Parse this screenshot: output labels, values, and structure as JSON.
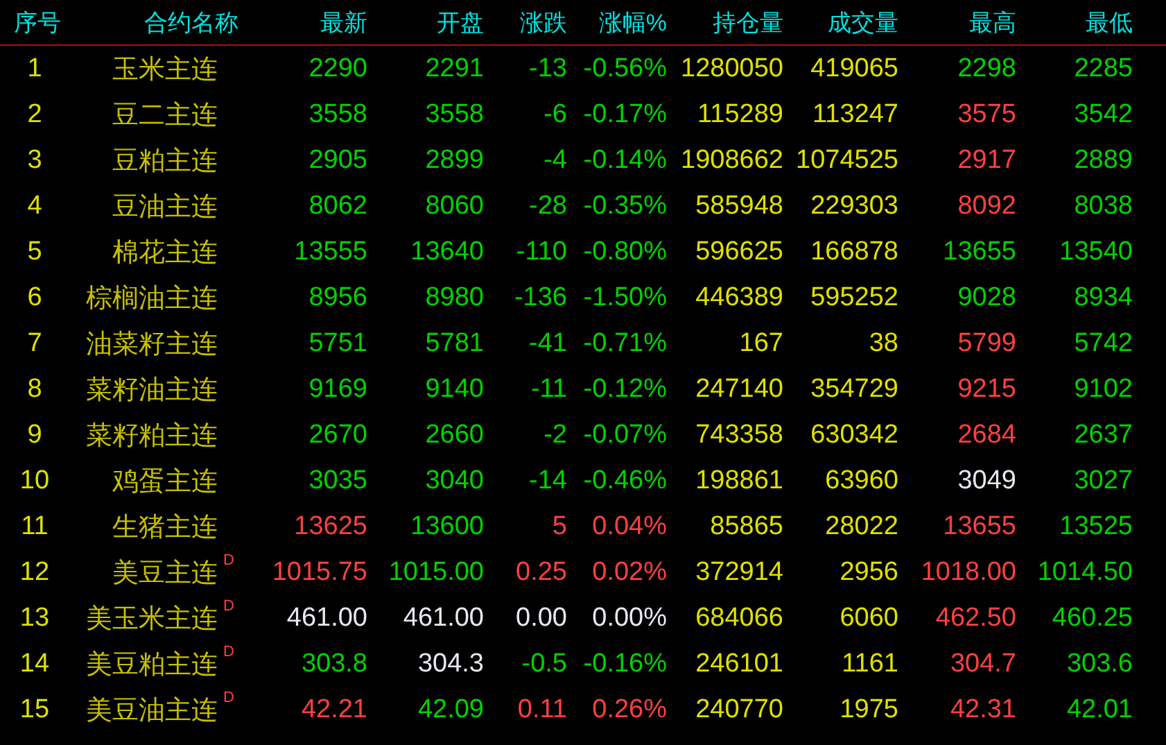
{
  "columns": [
    "序号",
    "合约名称",
    "最新",
    "开盘",
    "涨跌",
    "涨幅%",
    "持仓量",
    "成交量",
    "最高",
    "最低"
  ],
  "rows": [
    {
      "no": "1",
      "name": "玉米主连",
      "last": {
        "text": "2290",
        "color": "#00d200"
      },
      "open": {
        "text": "2291",
        "color": "#00d200"
      },
      "change": {
        "text": "-13",
        "color": "#00d200"
      },
      "pct": {
        "text": "-0.56%",
        "color": "#00d200"
      },
      "oi": "1280050",
      "volume": "419065",
      "high": {
        "text": "2298",
        "color": "#00d200"
      },
      "low": {
        "text": "2285",
        "color": "#00d200"
      }
    },
    {
      "no": "2",
      "name": "豆二主连",
      "last": {
        "text": "3558",
        "color": "#00d200"
      },
      "open": {
        "text": "3558",
        "color": "#00d200"
      },
      "change": {
        "text": "-6",
        "color": "#00d200"
      },
      "pct": {
        "text": "-0.17%",
        "color": "#00d200"
      },
      "oi": "115289",
      "volume": "113247",
      "high": {
        "text": "3575",
        "color": "#ff4040"
      },
      "low": {
        "text": "3542",
        "color": "#00d200"
      }
    },
    {
      "no": "3",
      "name": "豆粕主连",
      "last": {
        "text": "2905",
        "color": "#00d200"
      },
      "open": {
        "text": "2899",
        "color": "#00d200"
      },
      "change": {
        "text": "-4",
        "color": "#00d200"
      },
      "pct": {
        "text": "-0.14%",
        "color": "#00d200"
      },
      "oi": "1908662",
      "volume": "1074525",
      "high": {
        "text": "2917",
        "color": "#ff4040"
      },
      "low": {
        "text": "2889",
        "color": "#00d200"
      }
    },
    {
      "no": "4",
      "name": "豆油主连",
      "last": {
        "text": "8062",
        "color": "#00d200"
      },
      "open": {
        "text": "8060",
        "color": "#00d200"
      },
      "change": {
        "text": "-28",
        "color": "#00d200"
      },
      "pct": {
        "text": "-0.35%",
        "color": "#00d200"
      },
      "oi": "585948",
      "volume": "229303",
      "high": {
        "text": "8092",
        "color": "#ff4040"
      },
      "low": {
        "text": "8038",
        "color": "#00d200"
      }
    },
    {
      "no": "5",
      "name": "棉花主连",
      "last": {
        "text": "13555",
        "color": "#00d200"
      },
      "open": {
        "text": "13640",
        "color": "#00d200"
      },
      "change": {
        "text": "-110",
        "color": "#00d200"
      },
      "pct": {
        "text": "-0.80%",
        "color": "#00d200"
      },
      "oi": "596625",
      "volume": "166878",
      "high": {
        "text": "13655",
        "color": "#00d200"
      },
      "low": {
        "text": "13540",
        "color": "#00d200"
      }
    },
    {
      "no": "6",
      "name": "棕榈油主连",
      "last": {
        "text": "8956",
        "color": "#00d200"
      },
      "open": {
        "text": "8980",
        "color": "#00d200"
      },
      "change": {
        "text": "-136",
        "color": "#00d200"
      },
      "pct": {
        "text": "-1.50%",
        "color": "#00d200"
      },
      "oi": "446389",
      "volume": "595252",
      "high": {
        "text": "9028",
        "color": "#00d200"
      },
      "low": {
        "text": "8934",
        "color": "#00d200"
      }
    },
    {
      "no": "7",
      "name": "油菜籽主连",
      "last": {
        "text": "5751",
        "color": "#00d200"
      },
      "open": {
        "text": "5781",
        "color": "#00d200"
      },
      "change": {
        "text": "-41",
        "color": "#00d200"
      },
      "pct": {
        "text": "-0.71%",
        "color": "#00d200"
      },
      "oi": "167",
      "volume": "38",
      "high": {
        "text": "5799",
        "color": "#ff4040"
      },
      "low": {
        "text": "5742",
        "color": "#00d200"
      }
    },
    {
      "no": "8",
      "name": "菜籽油主连",
      "last": {
        "text": "9169",
        "color": "#00d200"
      },
      "open": {
        "text": "9140",
        "color": "#00d200"
      },
      "change": {
        "text": "-11",
        "color": "#00d200"
      },
      "pct": {
        "text": "-0.12%",
        "color": "#00d200"
      },
      "oi": "247140",
      "volume": "354729",
      "high": {
        "text": "9215",
        "color": "#ff4040"
      },
      "low": {
        "text": "9102",
        "color": "#00d200"
      }
    },
    {
      "no": "9",
      "name": "菜籽粕主连",
      "last": {
        "text": "2670",
        "color": "#00d200"
      },
      "open": {
        "text": "2660",
        "color": "#00d200"
      },
      "change": {
        "text": "-2",
        "color": "#00d200"
      },
      "pct": {
        "text": "-0.07%",
        "color": "#00d200"
      },
      "oi": "743358",
      "volume": "630342",
      "high": {
        "text": "2684",
        "color": "#ff4040"
      },
      "low": {
        "text": "2637",
        "color": "#00d200"
      }
    },
    {
      "no": "10",
      "name": "鸡蛋主连",
      "last": {
        "text": "3035",
        "color": "#00d200"
      },
      "open": {
        "text": "3040",
        "color": "#00d200"
      },
      "change": {
        "text": "-14",
        "color": "#00d200"
      },
      "pct": {
        "text": "-0.46%",
        "color": "#00d200"
      },
      "oi": "198861",
      "volume": "63960",
      "high": {
        "text": "3049",
        "color": "#e8e8f0"
      },
      "low": {
        "text": "3027",
        "color": "#00d200"
      }
    },
    {
      "no": "11",
      "name": "生猪主连",
      "last": {
        "text": "13625",
        "color": "#ff4040"
      },
      "open": {
        "text": "13600",
        "color": "#00d200"
      },
      "change": {
        "text": "5",
        "color": "#ff4040"
      },
      "pct": {
        "text": "0.04%",
        "color": "#ff4040"
      },
      "oi": "85865",
      "volume": "28022",
      "high": {
        "text": "13655",
        "color": "#ff4040"
      },
      "low": {
        "text": "13525",
        "color": "#00d200"
      }
    },
    {
      "no": "12",
      "name": "美豆主连",
      "tag": "D",
      "last": {
        "text": "1015.75",
        "color": "#ff4040"
      },
      "open": {
        "text": "1015.00",
        "color": "#00d200"
      },
      "change": {
        "text": "0.25",
        "color": "#ff4040"
      },
      "pct": {
        "text": "0.02%",
        "color": "#ff4040"
      },
      "oi": "372914",
      "volume": "2956",
      "high": {
        "text": "1018.00",
        "color": "#ff4040"
      },
      "low": {
        "text": "1014.50",
        "color": "#00d200"
      }
    },
    {
      "no": "13",
      "name": "美玉米主连",
      "tag": "D",
      "last": {
        "text": "461.00",
        "color": "#e8e8f0"
      },
      "open": {
        "text": "461.00",
        "color": "#e8e8f0"
      },
      "change": {
        "text": "0.00",
        "color": "#e8e8f0"
      },
      "pct": {
        "text": "0.00%",
        "color": "#e8e8f0"
      },
      "oi": "684066",
      "volume": "6060",
      "high": {
        "text": "462.50",
        "color": "#ff4040"
      },
      "low": {
        "text": "460.25",
        "color": "#00d200"
      }
    },
    {
      "no": "14",
      "name": "美豆粕主连",
      "tag": "D",
      "last": {
        "text": "303.8",
        "color": "#00d200"
      },
      "open": {
        "text": "304.3",
        "color": "#e8e8f0"
      },
      "change": {
        "text": "-0.5",
        "color": "#00d200"
      },
      "pct": {
        "text": "-0.16%",
        "color": "#00d200"
      },
      "oi": "246101",
      "volume": "1161",
      "high": {
        "text": "304.7",
        "color": "#ff4040"
      },
      "low": {
        "text": "303.6",
        "color": "#00d200"
      }
    },
    {
      "no": "15",
      "name": "美豆油主连",
      "tag": "D",
      "last": {
        "text": "42.21",
        "color": "#ff4040"
      },
      "open": {
        "text": "42.09",
        "color": "#00d200"
      },
      "change": {
        "text": "0.11",
        "color": "#ff4040"
      },
      "pct": {
        "text": "0.26%",
        "color": "#ff4040"
      },
      "oi": "240770",
      "volume": "1975",
      "high": {
        "text": "42.31",
        "color": "#ff4040"
      },
      "low": {
        "text": "42.01",
        "color": "#00d200"
      }
    }
  ]
}
